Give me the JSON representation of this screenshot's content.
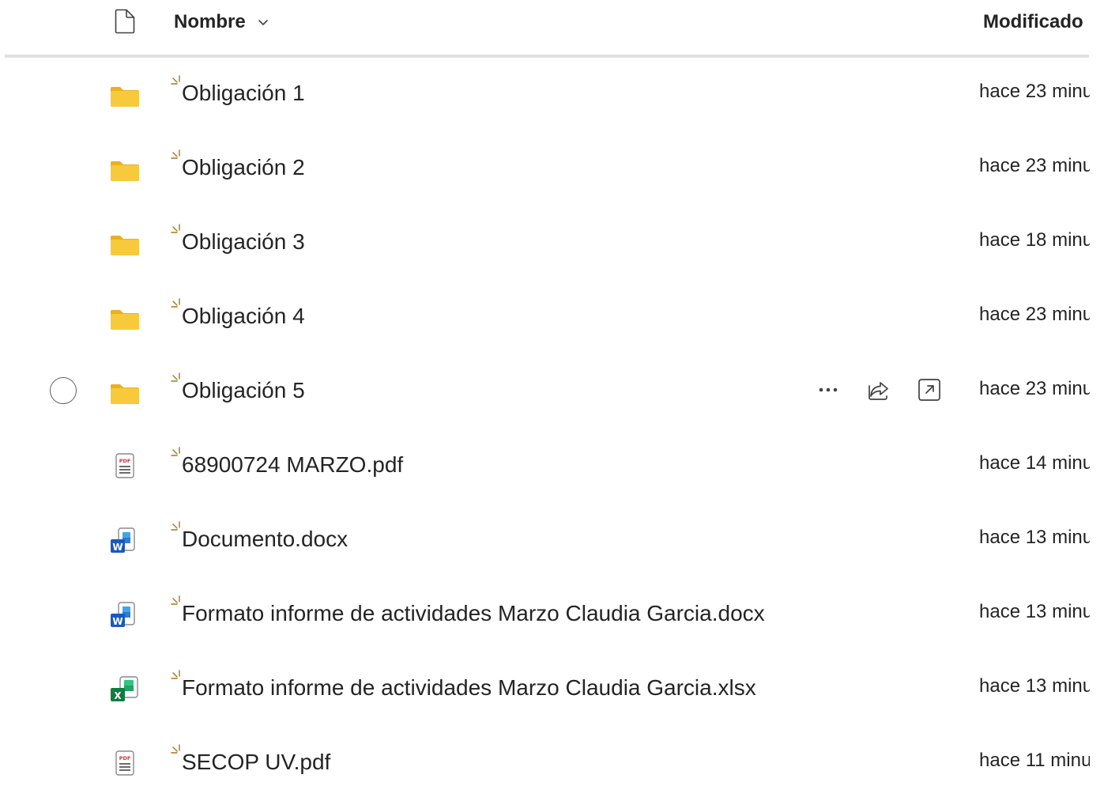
{
  "header": {
    "name_label": "Nombre",
    "modified_label": "Modificado",
    "file_type_icon": "document-icon",
    "sort_icon": "chevron-down-icon"
  },
  "colors": {
    "folder": "#f8c93a",
    "folder_dark": "#e9b021",
    "word": "#185abd",
    "excel": "#107c41",
    "pdf": "#d13438",
    "new_mark": "#a8741a"
  },
  "rows": [
    {
      "name": "Obligación 1",
      "type": "folder",
      "icon": "folder-icon",
      "modified": "hace 23 minu"
    },
    {
      "name": "Obligación 2",
      "type": "folder",
      "icon": "folder-icon",
      "modified": "hace 23 minu"
    },
    {
      "name": "Obligación 3",
      "type": "folder",
      "icon": "folder-icon",
      "modified": "hace 18 minu"
    },
    {
      "name": "Obligación 4",
      "type": "folder",
      "icon": "folder-icon",
      "modified": "hace 23 minu"
    },
    {
      "name": "Obligación 5",
      "type": "folder",
      "icon": "folder-icon",
      "modified": "hace 23 minu",
      "hovered": true,
      "actions": [
        "more-icon",
        "share-icon",
        "open-icon"
      ]
    },
    {
      "name": "68900724 MARZO.pdf",
      "type": "pdf",
      "icon": "pdf-file-icon",
      "modified": "hace 14 minu"
    },
    {
      "name": "Documento.docx",
      "type": "word",
      "icon": "word-file-icon",
      "modified": "hace 13 minu"
    },
    {
      "name": "Formato informe de actividades Marzo Claudia Garcia.docx",
      "type": "word",
      "icon": "word-file-icon",
      "modified": "hace 13 minu"
    },
    {
      "name": "Formato informe de actividades Marzo Claudia Garcia.xlsx",
      "type": "excel",
      "icon": "excel-file-icon",
      "modified": "hace 13 minu"
    },
    {
      "name": "SECOP UV.pdf",
      "type": "pdf",
      "icon": "pdf-file-icon",
      "modified": "hace 11 minu"
    }
  ]
}
